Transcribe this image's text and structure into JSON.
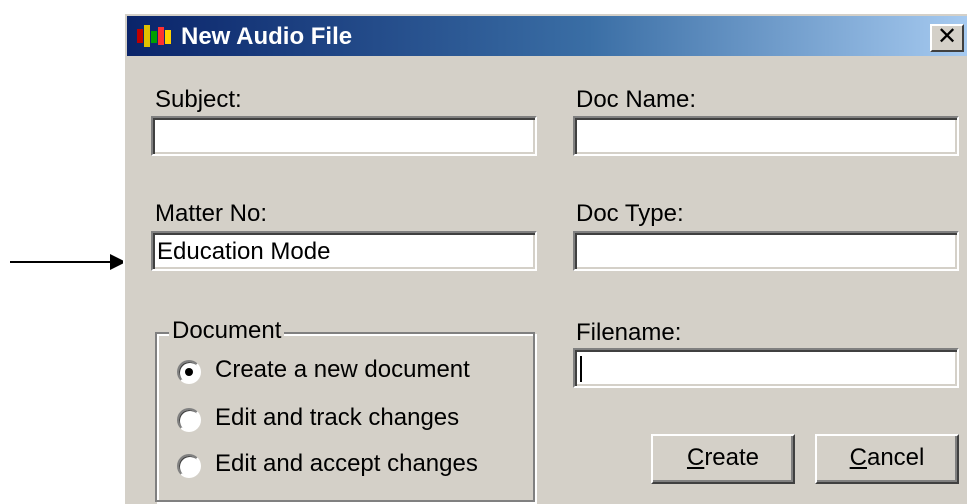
{
  "window": {
    "title": "New Audio File",
    "close_glyph": "✕"
  },
  "fields": {
    "subject": {
      "label": "Subject:",
      "value": ""
    },
    "doc_name": {
      "label": "Doc Name:",
      "value": ""
    },
    "matter_no": {
      "label": "Matter No:",
      "value": "Education Mode"
    },
    "doc_type": {
      "label": "Doc Type:",
      "value": ""
    },
    "filename": {
      "label": "Filename:",
      "value": ""
    }
  },
  "document_group": {
    "legend": "Document",
    "options": [
      {
        "label": "Create a new document",
        "checked": true
      },
      {
        "label": "Edit and track changes",
        "checked": false
      },
      {
        "label": "Edit and accept changes",
        "checked": false
      }
    ]
  },
  "buttons": {
    "create": {
      "label_prefix": "",
      "label_ul": "C",
      "label_rest": "reate"
    },
    "cancel": {
      "label_prefix": "",
      "label_ul": "C",
      "label_rest": "ancel"
    }
  },
  "icons": {
    "app": "app-icon",
    "arrow": "arrow-right-icon",
    "close": "close-icon"
  }
}
